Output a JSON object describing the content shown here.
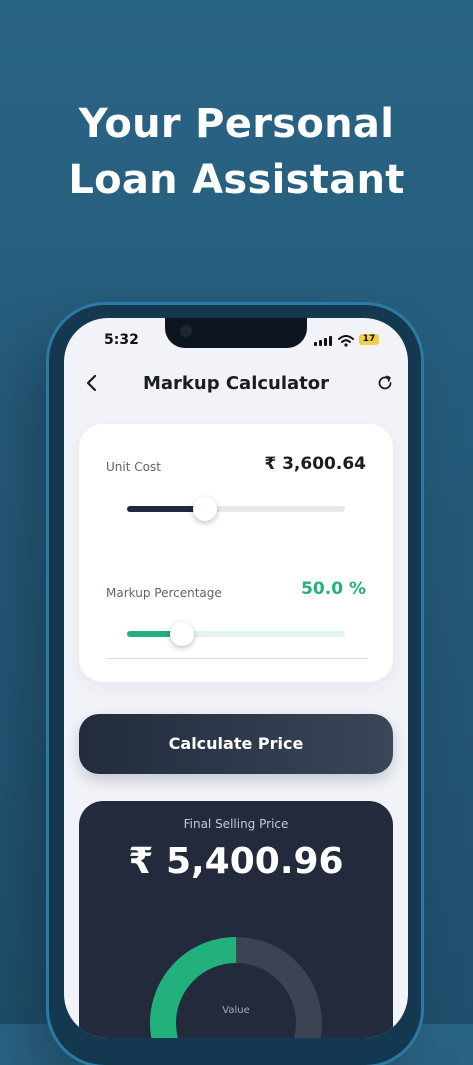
{
  "promo": {
    "headline": "Your Personal\nLoan Assistant"
  },
  "status_bar": {
    "time": "5:32",
    "battery": "17",
    "icons": [
      "signal-icon",
      "wifi-icon",
      "battery-icon"
    ]
  },
  "nav": {
    "back_icon": "chevron-left-icon",
    "title": "Markup Calculator",
    "refresh_icon": "refresh-icon"
  },
  "inputs": {
    "unit_cost": {
      "label": "Unit Cost",
      "value": "₹ 3,600.64",
      "slider_fraction": 0.36,
      "fill_color": "#1f2a3d"
    },
    "markup": {
      "label": "Markup Percentage",
      "value": "50.0 %",
      "slider_fraction": 0.25,
      "fill_color": "#22b07d"
    }
  },
  "action": {
    "calculate_label": "Calculate Price"
  },
  "result": {
    "label": "Final Selling Price",
    "value": "₹ 5,400.96",
    "chart_caption": "Value",
    "donut_fraction_green": 0.5,
    "colors": {
      "green": "#22b07d",
      "grey": "#3c4454"
    }
  },
  "colors": {
    "background": "#245a79",
    "accent_green": "#22b07d",
    "dark": "#232a3b"
  }
}
